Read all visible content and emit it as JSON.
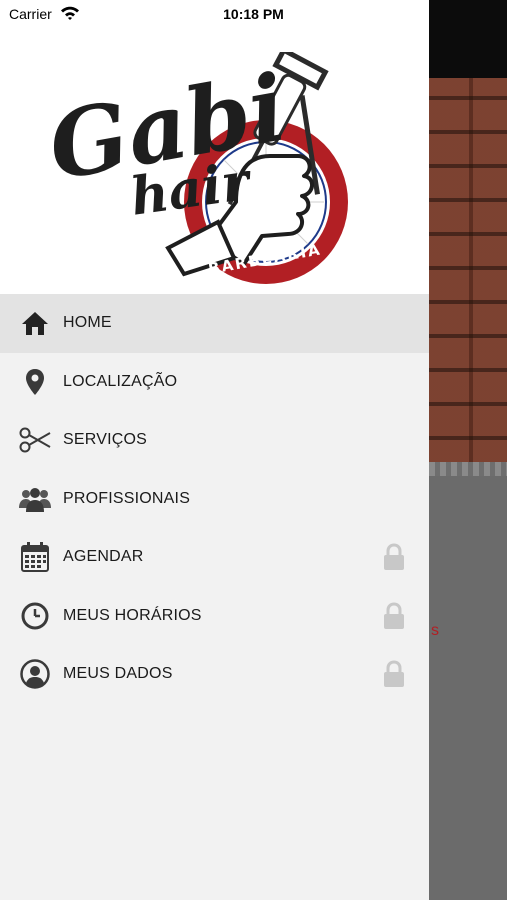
{
  "status_bar": {
    "carrier": "Carrier",
    "time": "10:18 PM"
  },
  "logo": {
    "line1": "Gabi",
    "line2": "hair",
    "ribbon": "BARBEARIA"
  },
  "menu": {
    "items": [
      {
        "label": "HOME",
        "icon": "home-icon",
        "active": true,
        "locked": false
      },
      {
        "label": "LOCALIZAÇÃO",
        "icon": "map-pin-icon",
        "active": false,
        "locked": false
      },
      {
        "label": "SERVIÇOS",
        "icon": "scissors-icon",
        "active": false,
        "locked": false
      },
      {
        "label": "PROFISSIONAIS",
        "icon": "users-icon",
        "active": false,
        "locked": false
      },
      {
        "label": "AGENDAR",
        "icon": "calendar-icon",
        "active": false,
        "locked": true
      },
      {
        "label": "MEUS HORÁRIOS",
        "icon": "clock-icon",
        "active": false,
        "locked": true
      },
      {
        "label": "MEUS DADOS",
        "icon": "user-circle-icon",
        "active": false,
        "locked": true
      }
    ]
  },
  "colors": {
    "brand_red": "#b21f24",
    "drawer_bg": "#f2f2f2",
    "active_row": "#e3e3e3",
    "lock_gray": "#c8c8c8"
  }
}
